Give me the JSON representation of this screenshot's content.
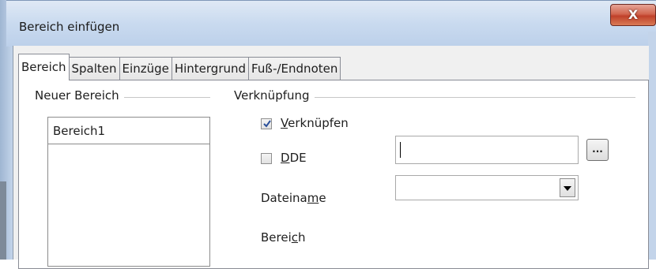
{
  "window": {
    "title": "Bereich einfügen",
    "close_glyph": "X"
  },
  "tabs": [
    {
      "label": "Bereich",
      "active": true
    },
    {
      "label": "Spalten",
      "active": false
    },
    {
      "label": "Einzüge",
      "active": false
    },
    {
      "label": "Hintergrund",
      "active": false
    },
    {
      "label": "Fuß-/Endnoten",
      "active": false
    }
  ],
  "new_section": {
    "group_label": "Neuer Bereich",
    "entries": [
      "Bereich1"
    ]
  },
  "link": {
    "group_label": "Verknüpfung",
    "link_checkbox": {
      "label": "Verknüpfen",
      "mnemonic": "V",
      "checked": true
    },
    "dde_checkbox": {
      "label": "DDE",
      "mnemonic": "D",
      "checked": false
    },
    "filename": {
      "label": "Dateiname",
      "label_pre": "Dateina",
      "mnemonic": "m",
      "label_post": "e",
      "value": ""
    },
    "browse_label": "...",
    "section": {
      "label": "Bereich",
      "label_pre": "Berei",
      "mnemonic": "c",
      "label_post": "h",
      "value": ""
    }
  },
  "colors": {
    "titlebar": "#c9daef",
    "close_button": "#c0412a",
    "panel_background": "#ffffff",
    "dialog_background": "#f0f0f0"
  },
  "icons": {
    "close": "close-icon",
    "checkmark": "checkmark-icon",
    "dropdown": "chevron-down-icon"
  }
}
